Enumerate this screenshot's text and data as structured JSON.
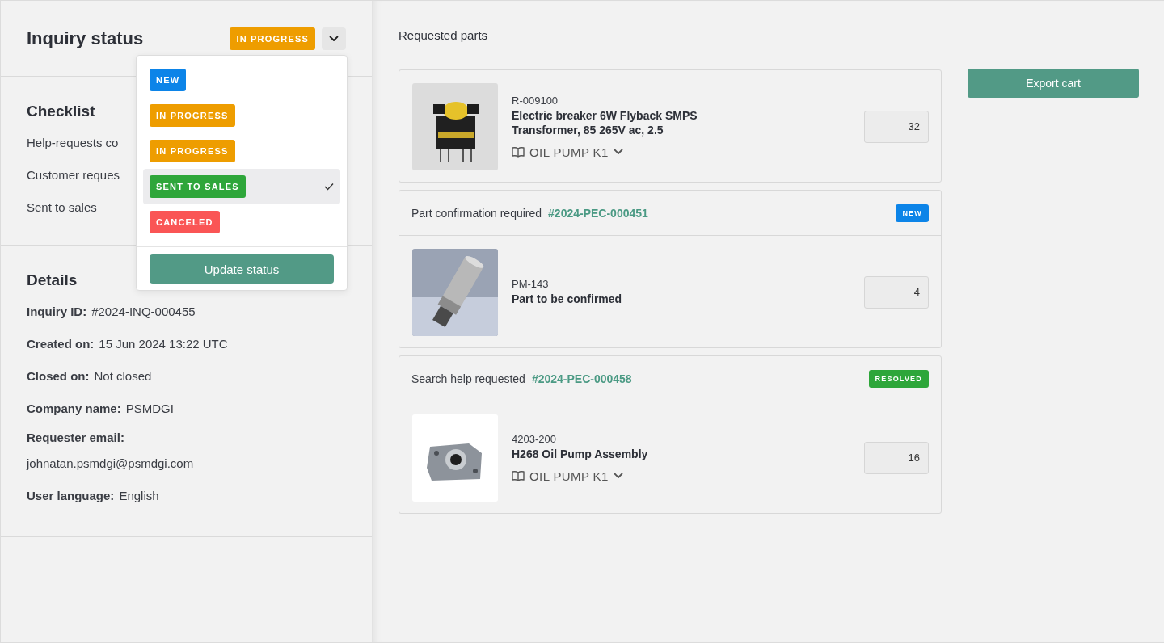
{
  "inquiry_status": {
    "title": "Inquiry status",
    "current": {
      "label": "IN PROGRESS",
      "color": "#ee9d00"
    }
  },
  "status_menu": {
    "options": [
      {
        "label": "NEW",
        "color": "#0c84e8",
        "selected": false
      },
      {
        "label": "IN PROGRESS",
        "color": "#ee9d00",
        "selected": false
      },
      {
        "label": "IN PROGRESS",
        "color": "#ee9d00",
        "selected": false
      },
      {
        "label": "SENT TO SALES",
        "color": "#2ea63a",
        "selected": true
      },
      {
        "label": "CANCELED",
        "color": "#fa5555",
        "selected": false
      }
    ],
    "button": "Update status"
  },
  "checklist": {
    "title": "Checklist",
    "items": [
      "Help-requests co",
      "Customer reques",
      "Sent to sales"
    ]
  },
  "details": {
    "title": "Details",
    "fields": [
      {
        "label": "Inquiry ID:",
        "value": "#2024-INQ-000455",
        "kind": "inline"
      },
      {
        "label": "Created on:",
        "value": "15 Jun 2024 13:22 UTC",
        "kind": "inline"
      },
      {
        "label": "Closed on:",
        "value": "Not closed",
        "kind": "inline"
      },
      {
        "label": "Company name:",
        "value": "PSMDGI",
        "kind": "inline"
      },
      {
        "label": "Requester email:",
        "value": "johnatan.psmdgi@psmdgi.com",
        "kind": "block"
      },
      {
        "label": "User language:",
        "value": "English",
        "kind": "inline"
      }
    ]
  },
  "requested_parts": {
    "title": "Requested parts",
    "cards": [
      {
        "part": {
          "number": "R-009100",
          "name": "Electric breaker 6W Flyback SMPS Transformer, 85 265V ac, 2.5",
          "catalog": "OIL PUMP K1",
          "quantity": "32"
        }
      },
      {
        "header": {
          "text": "Part confirmation required",
          "link": "#2024-PEC-000451",
          "badge": {
            "label": "NEW",
            "color": "#0c84e8"
          }
        },
        "part": {
          "number": "PM-143",
          "name": "Part to be confirmed",
          "quantity": "4"
        }
      },
      {
        "header": {
          "text": "Search help requested",
          "link": "#2024-PEC-000458",
          "badge": {
            "label": "RESOLVED",
            "color": "#2ea63a"
          }
        },
        "part": {
          "number": "4203-200",
          "name": "H268 Oil Pump Assembly",
          "catalog": "OIL PUMP K1",
          "quantity": "16"
        }
      }
    ]
  },
  "export_button": "Export cart"
}
